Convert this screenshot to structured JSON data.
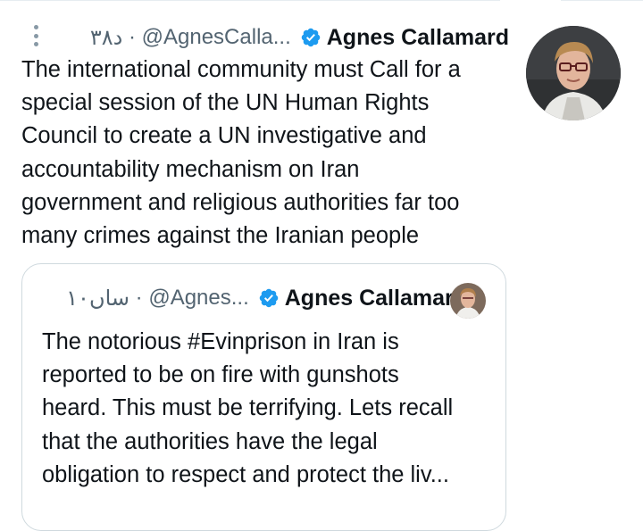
{
  "tweet": {
    "author_name": "Agnes Callamard",
    "handle": "@AgnesCalla...",
    "separator": "·",
    "time": "۳۸د",
    "text_lines": [
      "The international community must  Call for a",
      "special session of the UN Human Rights",
      "Council to create a UN investigative and",
      "accountability mechanism on Iran",
      "government and religious authorities far too",
      "many crimes against the Iranian people"
    ]
  },
  "quoted_tweet": {
    "author_name": "Agnes Callamard",
    "handle": "@Agnes...",
    "separator": "·",
    "time": "۱۰ساں",
    "text_lines": [
      "The notorious #Evinprison in Iran is",
      "reported to be on fire with gunshots",
      "heard. This must be terrifying. Lets recall",
      "that the authorities have the legal",
      "obligation to respect and protect the liv..."
    ]
  },
  "icons": {
    "more": "more-vertical-icon",
    "verified": "verified-badge-icon"
  },
  "colors": {
    "verified_blue": "#1d9bf0",
    "secondary_text": "#536471",
    "border": "#cfd9de"
  }
}
